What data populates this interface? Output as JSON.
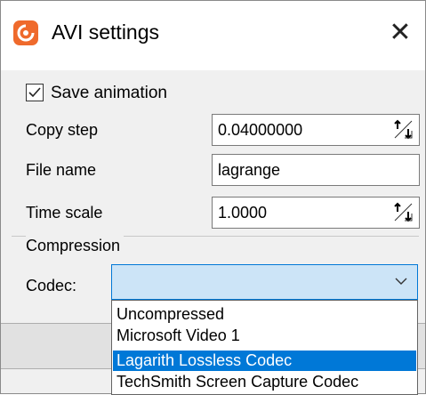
{
  "window": {
    "title": "AVI settings",
    "close_glyph": "✕",
    "app_icon": "app-logo-icon",
    "accent_color": "#ef6a2c"
  },
  "save_animation": {
    "label": "Save animation",
    "checked": true
  },
  "copy_step": {
    "label": "Copy step",
    "value": "0.04000000"
  },
  "file_name": {
    "label": "File name",
    "value": "lagrange"
  },
  "time_scale": {
    "label": "Time scale",
    "value": "1.0000"
  },
  "compression": {
    "group_title": "Compression",
    "codec_label": "Codec:",
    "codec_value": "",
    "options": [
      {
        "label": "Uncompressed",
        "selected": false
      },
      {
        "label": "Microsoft Video 1",
        "selected": false
      },
      {
        "label": "Lagarith Lossless Codec",
        "selected": true
      },
      {
        "label": "TechSmith Screen Capture Codec",
        "selected": false
      }
    ],
    "highlight_color": "#0078d7"
  }
}
